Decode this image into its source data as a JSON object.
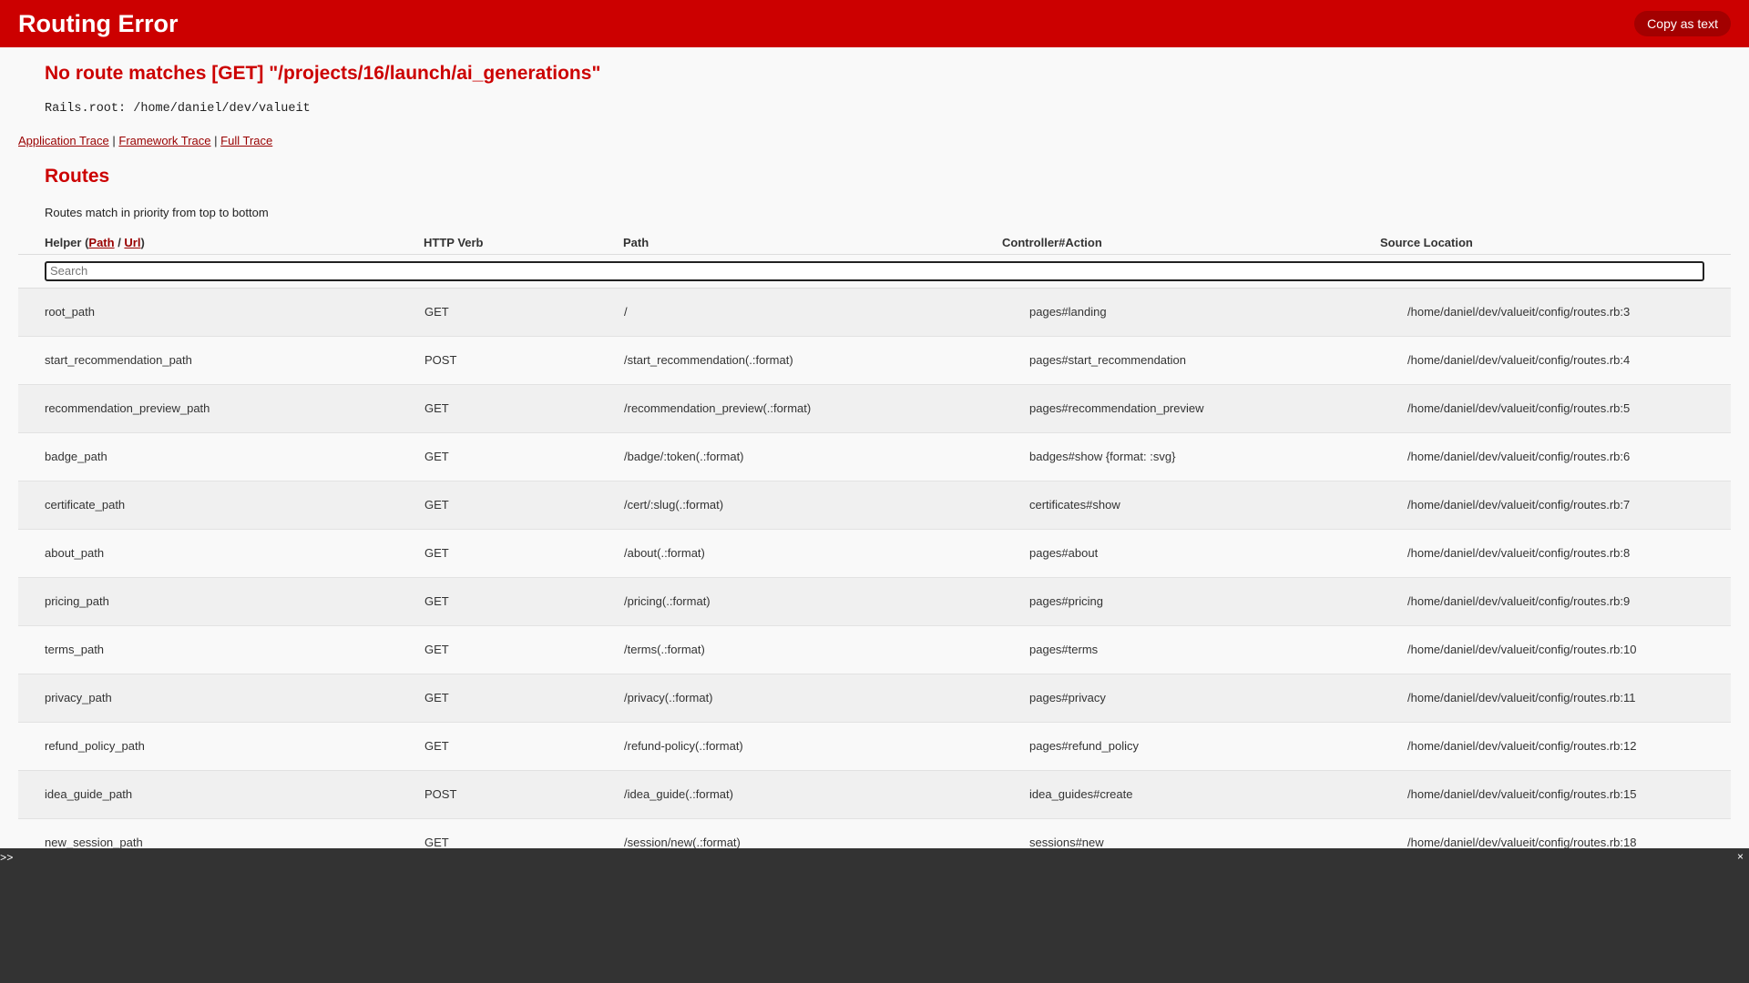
{
  "header": {
    "title": "Routing Error",
    "copy_button": "Copy as text"
  },
  "error": {
    "message": "No route matches [GET] \"/projects/16/launch/ai_generations\"",
    "rails_root": "Rails.root: /home/daniel/dev/valueit"
  },
  "trace_links": {
    "application": "Application Trace",
    "framework": "Framework Trace",
    "full": "Full Trace",
    "separator": "|"
  },
  "routes": {
    "title": "Routes",
    "subtitle": "Routes match in priority from top to bottom",
    "columns": {
      "helper_prefix": "Helper (",
      "helper_path": "Path",
      "helper_sep": " / ",
      "helper_url": "Url",
      "helper_suffix": ")",
      "verb": "HTTP Verb",
      "path": "Path",
      "controller": "Controller#Action",
      "source": "Source Location"
    },
    "search_placeholder": "Search",
    "rows": [
      {
        "helper": "root_path",
        "verb": "GET",
        "path": "/",
        "controller": "pages#landing",
        "source": "/home/daniel/dev/valueit/config/routes.rb:3"
      },
      {
        "helper": "start_recommendation_path",
        "verb": "POST",
        "path": "/start_recommendation(.:format)",
        "controller": "pages#start_recommendation",
        "source": "/home/daniel/dev/valueit/config/routes.rb:4"
      },
      {
        "helper": "recommendation_preview_path",
        "verb": "GET",
        "path": "/recommendation_preview(.:format)",
        "controller": "pages#recommendation_preview",
        "source": "/home/daniel/dev/valueit/config/routes.rb:5"
      },
      {
        "helper": "badge_path",
        "verb": "GET",
        "path": "/badge/:token(.:format)",
        "controller": "badges#show {format: :svg}",
        "source": "/home/daniel/dev/valueit/config/routes.rb:6"
      },
      {
        "helper": "certificate_path",
        "verb": "GET",
        "path": "/cert/:slug(.:format)",
        "controller": "certificates#show",
        "source": "/home/daniel/dev/valueit/config/routes.rb:7"
      },
      {
        "helper": "about_path",
        "verb": "GET",
        "path": "/about(.:format)",
        "controller": "pages#about",
        "source": "/home/daniel/dev/valueit/config/routes.rb:8"
      },
      {
        "helper": "pricing_path",
        "verb": "GET",
        "path": "/pricing(.:format)",
        "controller": "pages#pricing",
        "source": "/home/daniel/dev/valueit/config/routes.rb:9"
      },
      {
        "helper": "terms_path",
        "verb": "GET",
        "path": "/terms(.:format)",
        "controller": "pages#terms",
        "source": "/home/daniel/dev/valueit/config/routes.rb:10"
      },
      {
        "helper": "privacy_path",
        "verb": "GET",
        "path": "/privacy(.:format)",
        "controller": "pages#privacy",
        "source": "/home/daniel/dev/valueit/config/routes.rb:11"
      },
      {
        "helper": "refund_policy_path",
        "verb": "GET",
        "path": "/refund-policy(.:format)",
        "controller": "pages#refund_policy",
        "source": "/home/daniel/dev/valueit/config/routes.rb:12"
      },
      {
        "helper": "idea_guide_path",
        "verb": "POST",
        "path": "/idea_guide(.:format)",
        "controller": "idea_guides#create",
        "source": "/home/daniel/dev/valueit/config/routes.rb:15"
      },
      {
        "helper": "new_session_path",
        "verb": "GET",
        "path": "/session/new(.:format)",
        "controller": "sessions#new",
        "source": "/home/daniel/dev/valueit/config/routes.rb:18"
      }
    ]
  },
  "console": {
    "prompt": ">>",
    "close": "×"
  },
  "colors": {
    "header_bg": "#cc0000",
    "accent": "#cc0000",
    "link": "#990000",
    "console_bg": "#333333"
  }
}
